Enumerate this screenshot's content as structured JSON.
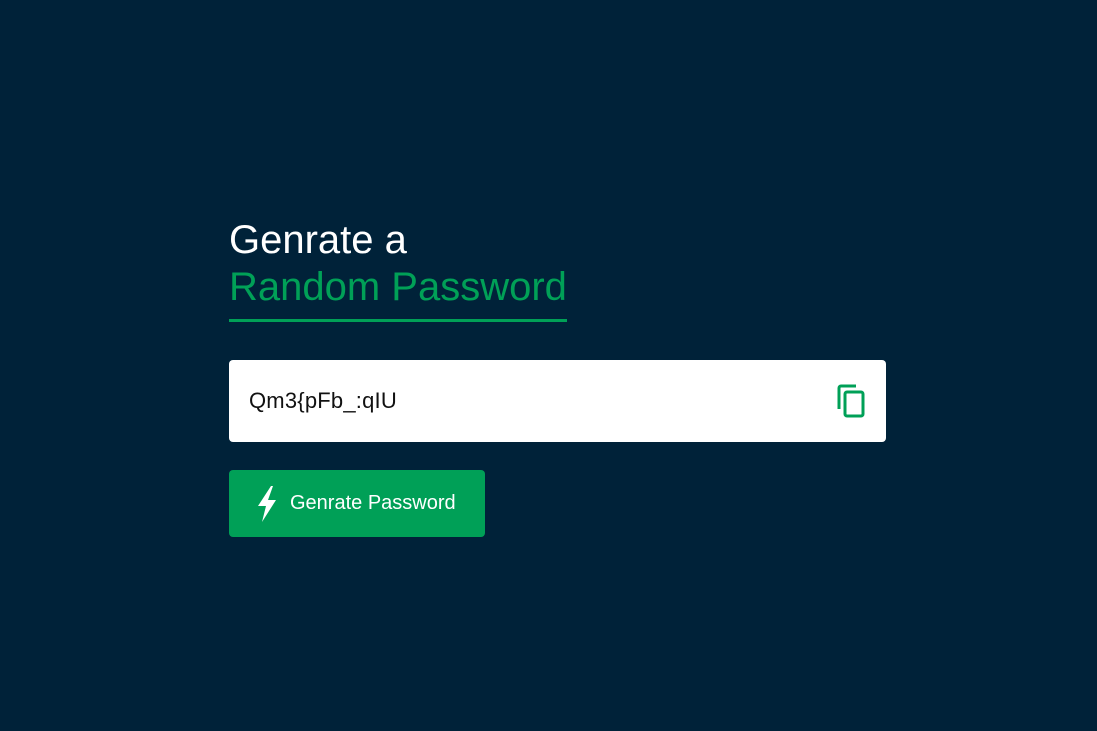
{
  "header": {
    "line1": "Genrate a",
    "line2": "Random Password"
  },
  "password": {
    "value": "Qm3{pFb_:qIU"
  },
  "copy_button": {
    "icon": "copy-icon"
  },
  "generate_button": {
    "label": "Genrate Password",
    "icon": "lightning-icon"
  },
  "colors": {
    "background": "#002239",
    "accent": "#00a057",
    "text_light": "#ffffff"
  }
}
